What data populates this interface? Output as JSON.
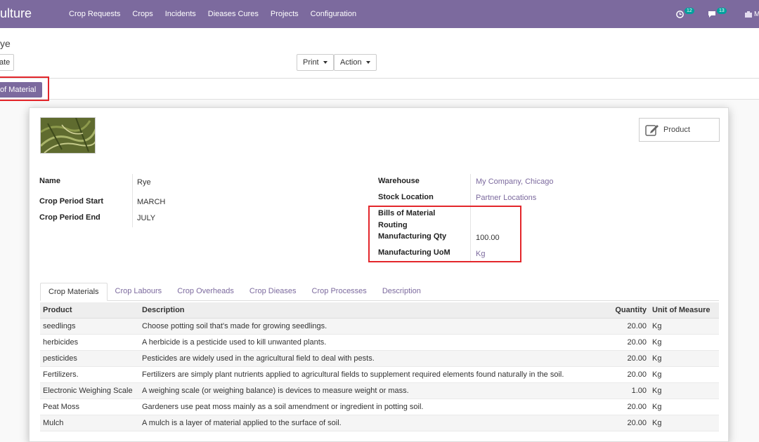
{
  "navbar": {
    "brand": "ulture",
    "menu": [
      "Crop Requests",
      "Crops",
      "Incidents",
      "Dieases Cures",
      "Projects",
      "Configuration"
    ],
    "activity_count": "12",
    "message_count": "13",
    "user_initial": "M"
  },
  "control_panel": {
    "breadcrumb": "ye",
    "create_label": "ate",
    "print_label": "Print",
    "action_label": "Action"
  },
  "statusbar": {
    "bom_button": "of Material"
  },
  "form": {
    "smart_button": "Product",
    "left": [
      {
        "label": "Name",
        "value": "Rye"
      },
      {
        "label": "Crop Period Start",
        "value": "MARCH"
      },
      {
        "label": "Crop Period End",
        "value": "JULY"
      }
    ],
    "right": {
      "warehouse_label": "Warehouse",
      "warehouse_value": "My Company, Chicago",
      "stock_location_label": "Stock Location",
      "stock_location_value": "Partner Locations",
      "bom_label": "Bills of Material",
      "routing_label": "Routing",
      "mfg_qty_label": "Manufacturing Qty",
      "mfg_qty_value": "100.00",
      "mfg_uom_label": "Manufacturing UoM",
      "mfg_uom_value": "Kg"
    }
  },
  "tabs": [
    "Crop Materials",
    "Crop Labours",
    "Crop Overheads",
    "Crop Dieases",
    "Crop Processes",
    "Description"
  ],
  "table": {
    "headers": [
      "Product",
      "Description",
      "Quantity",
      "Unit of Measure"
    ],
    "rows": [
      [
        "seedlings",
        "Choose potting soil that's made for growing seedlings.",
        "20.00",
        "Kg"
      ],
      [
        "herbicides",
        "A herbicide is a pesticide used to kill unwanted plants.",
        "20.00",
        "Kg"
      ],
      [
        "pesticides",
        "Pesticides are widely used in the agricultural field to deal with pests.",
        "20.00",
        "Kg"
      ],
      [
        "Fertilizers.",
        "Fertilizers are simply plant nutrients applied to agricultural fields to supplement required elements found naturally in the soil.",
        "20.00",
        "Kg"
      ],
      [
        "Electronic Weighing Scale",
        "A weighing scale (or weighing balance) is devices to measure weight or mass.",
        "1.00",
        "Kg"
      ],
      [
        "Peat Moss",
        "Gardeners use peat moss mainly as a soil amendment or ingredient in potting soil.",
        "20.00",
        "Kg"
      ],
      [
        "Mulch",
        "A mulch is a layer of material applied to the surface of soil.",
        "20.00",
        "Kg"
      ]
    ]
  },
  "colors": {
    "primary": "#7c6a9e",
    "highlight": "#e3262b",
    "badge": "#00a09d"
  }
}
